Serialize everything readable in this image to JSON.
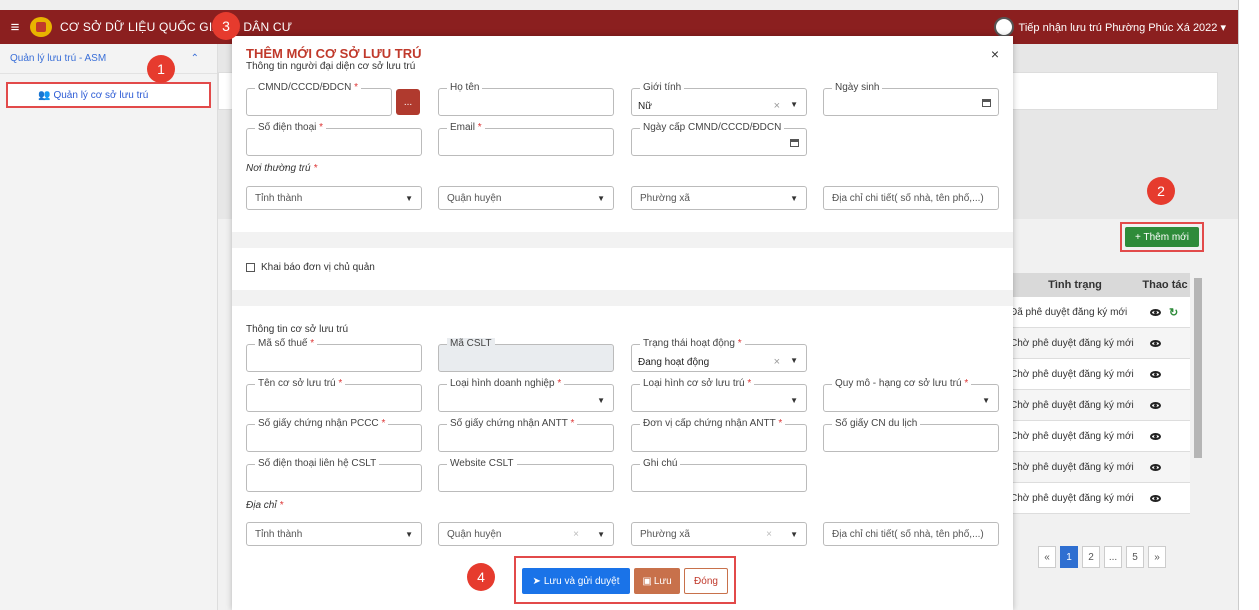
{
  "header": {
    "app_title": "CƠ SỞ DỮ LIỆU QUỐC GIA VỀ DÂN CƯ",
    "user_label": "Tiếp nhận lưu trú Phường Phúc Xá 2022 ▾"
  },
  "sidebar": {
    "group_label": "Quản lý lưu trú - ASM",
    "group_caret": "⌃",
    "item_label": "Quản lý cơ sở lưu trú"
  },
  "page": {
    "add_new_label": "+ Thêm mới",
    "table_headers": [
      "Tình trạng",
      "Thao tác"
    ],
    "table_rows": [
      "Đã phê duyệt đăng ký mới",
      "Chờ phê duyệt đăng ký mới",
      "Chờ phê duyệt đăng ký mới",
      "Chờ phê duyệt đăng ký mới",
      "Chờ phê duyệt đăng ký mới",
      "Chờ phê duyệt đăng ký mới",
      "Chờ phê duyệt đăng ký mới"
    ],
    "pager": [
      "«",
      "1",
      "2",
      "...",
      "5",
      "»"
    ]
  },
  "modal": {
    "title": "THÊM MỚI CƠ SỞ LƯU TRÚ",
    "close": "×",
    "rep_section": "Thông tin người đại diện cơ sở lưu trú",
    "cmnd_label": "CMND/CCCD/ĐDCN",
    "dots": "...",
    "ho_ten_label": "Họ tên",
    "gioi_tinh_label": "Giới tính",
    "gioi_tinh_value": "Nữ",
    "ngay_sinh_label": "Ngày sinh",
    "sdt_label": "Số điện thoại",
    "email_label": "Email",
    "ngay_cap_label": "Ngày cấp CMND/CCCD/ĐDCN",
    "noi_thuong_tru_label": "Nơi thường trú",
    "tinh_thanh": "Tỉnh thành",
    "quan_huyen": "Quận huyện",
    "phuong_xa": "Phường xã",
    "dia_chi_chi_tiet": "Địa chỉ chi tiết( số nhà, tên phố,...)",
    "checkbox_label": "Khai báo đơn vị chủ quản",
    "cslt_section": "Thông tin cơ sở lưu trú",
    "ma_so_thue_label": "Mã số thuế",
    "ma_cslt_label": "Mã CSLT",
    "trang_thai_label": "Trạng thái hoạt động",
    "trang_thai_value": "Đang hoạt động",
    "ten_cslt_label": "Tên cơ sở lưu trú",
    "loai_hinh_dn_label": "Loại hình doanh nghiệp",
    "loai_hinh_cslt_label": "Loại hình cơ sở lưu trú",
    "quy_mo_label": "Quy mô - hạng cơ sở lưu trú",
    "pccc_label": "Số giấy chứng nhận PCCC",
    "antt_label": "Số giấy chứng nhận ANTT",
    "don_vi_antt_label": "Đơn vị cấp chứng nhận ANTT",
    "cn_du_lich_label": "Số giấy CN du lịch",
    "sdt_lien_he_label": "Số điện thoại liên hệ CSLT",
    "website_label": "Website CSLT",
    "ghi_chu_label": "Ghi chú",
    "dia_chi_label": "Địa chỉ",
    "required_mark": "*",
    "clear_mark": "×",
    "caret": "▼",
    "btn_submit": "Lưu và gửi duyệt",
    "btn_save": "Lưu",
    "btn_close": "Đóng"
  },
  "steps": [
    "1",
    "2",
    "3",
    "4"
  ],
  "colors": {
    "topbar": "#8b1f1f",
    "accent_red": "#e63b2e",
    "primary": "#1a73e8",
    "save": "#c8714b",
    "success": "#2e8b3a"
  }
}
